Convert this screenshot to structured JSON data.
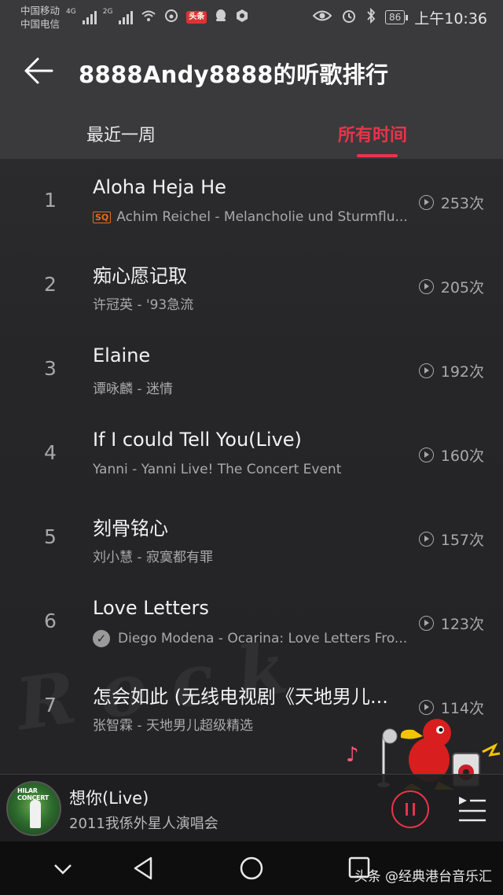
{
  "status_bar": {
    "carrier_1": "中国移动",
    "carrier_2": "中国电信",
    "net_1": "4G",
    "net_2": "2G",
    "news_badge": "头条",
    "battery": "86",
    "time": "上午10:36"
  },
  "header": {
    "title": "8888Andy8888的听歌排行",
    "tabs": [
      {
        "label": "最近一周",
        "active": false
      },
      {
        "label": "所有时间",
        "active": true
      }
    ],
    "accent_color": "#e8344a"
  },
  "songs": [
    {
      "rank": "1",
      "title": "Aloha Heja He",
      "subtitle": "Achim Reichel - Melancholie und Sturmflu...",
      "badge": "SQ",
      "plays": "253次"
    },
    {
      "rank": "2",
      "title": "痴心愿记取",
      "subtitle": "许冠英 - '93急流",
      "badge": "",
      "plays": "205次"
    },
    {
      "rank": "3",
      "title": "Elaine",
      "subtitle": "谭咏麟 - 迷情",
      "badge": "",
      "plays": "192次"
    },
    {
      "rank": "4",
      "title": "If I could Tell You(Live)",
      "subtitle": "Yanni - Yanni Live! The Concert Event",
      "badge": "",
      "plays": "160次"
    },
    {
      "rank": "5",
      "title": "刻骨铭心",
      "subtitle": "刘小慧 - 寂寞都有罪",
      "badge": "",
      "plays": "157次"
    },
    {
      "rank": "6",
      "title": "Love Letters",
      "subtitle": "Diego Modena - Ocarina: Love Letters Fro...",
      "badge": "check",
      "plays": "123次"
    },
    {
      "rank": "7",
      "title": "怎会如此 (无线电视剧《天地男儿...",
      "subtitle": "张智霖 - 天地男儿超级精选",
      "badge": "",
      "plays": "114次"
    }
  ],
  "now_playing": {
    "title": "想你(Live)",
    "subtitle": "2011我係外星人演唱会",
    "album_caption": "HILAR CONCERT"
  },
  "watermark": "头条 @经典港台音乐汇"
}
